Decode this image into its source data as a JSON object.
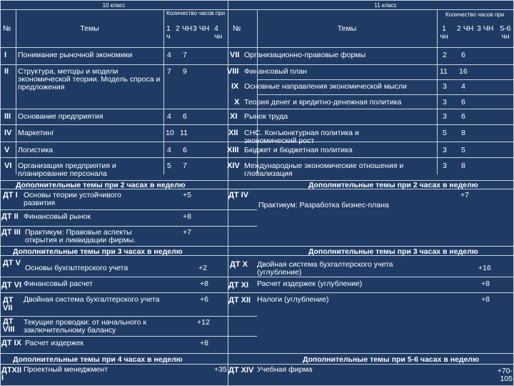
{
  "left_header": {
    "grade": "10 класс",
    "hours_title": "Количество часов при",
    "num": "№",
    "topics": "Темы",
    "col1": "1 ч",
    "col2": "2 ЧН",
    "col3": "3 ЧН",
    "col4": "4 чн"
  },
  "right_header": {
    "grade": "11 класс",
    "hours_title": "Количество часов при",
    "num": "№",
    "topics": "Темы",
    "col1": "1 чн",
    "col2": "2 ЧН",
    "col3": "3 ЧН",
    "col4": "5-6 чн"
  },
  "left_rows": [
    {
      "num": "I",
      "topic": "Понимание рыночной экономики",
      "h1": "4",
      "h2": "7"
    },
    {
      "num": "II",
      "topic": "Структура, методы и модели экономической теории. Модель спроса и предложения",
      "h1": "7",
      "h2": "9"
    },
    {
      "num": "III",
      "topic": "Основание предприятия",
      "h1": "4",
      "h2": "6"
    },
    {
      "num": "IV",
      "topic": "Маркетинг",
      "h1": "10",
      "h2": "11"
    },
    {
      "num": "V",
      "topic": "Логистика",
      "h1": "4",
      "h2": "6"
    },
    {
      "num": "VI",
      "topic": "Организация предприятия и планирование персонала",
      "h1": "5",
      "h2": "7"
    }
  ],
  "right_rows": [
    {
      "num": "VII",
      "topic": "Организационно-правовые формы",
      "h1": "2",
      "h2": "6"
    },
    {
      "num": "VIII",
      "topic": "Финансовый план",
      "h1": "11",
      "h2": "16"
    },
    {
      "num": "IX",
      "topic": "Основные направления экономической мысли",
      "h1": "3",
      "h2": "4"
    },
    {
      "num": "X",
      "topic": "Теория денег и кредитно-денежная политика",
      "h1": "3",
      "h2": "6"
    },
    {
      "num": "XI",
      "topic": "Рынок труда",
      "h1": "3",
      "h2": "6"
    },
    {
      "num": "XII",
      "topic": "СНС. Конъюнктурная политика и экономический рост",
      "h1": "5",
      "h2": "8"
    },
    {
      "num": "XIII",
      "topic": "Бюджет и бюджетная политика",
      "h1": "3",
      "h2": "5"
    },
    {
      "num": "XIV",
      "topic": "Международные экономические отношения и глобализация",
      "h1": "3",
      "h2": "8"
    }
  ],
  "left_add2": {
    "heading": "Дополнительные темы при 2 часах в неделю",
    "rows": [
      {
        "num": "ДТ I",
        "topic": "Основы теории устойчивого развития",
        "val": "+5"
      },
      {
        "num": "ДТ II",
        "topic": "Финансовый рынок",
        "val": "+8"
      },
      {
        "num": "ДТ III",
        "topic": "Практикум: Правовые аспекты открытия и ликвидации фирмы.",
        "val": "+7"
      }
    ]
  },
  "right_add2": {
    "heading": "Дополнительные темы при 2 часах в неделю",
    "rows": [
      {
        "num": "ДТ IV",
        "topic": "Практикум: Разработка бизнес-плана",
        "val": "+7"
      }
    ]
  },
  "left_add3": {
    "heading": "Дополнительные темы при 3 часах в неделю",
    "rows": [
      {
        "num": "ДТ V",
        "topic": "Основы бухгалтерского учета",
        "val": "+2"
      },
      {
        "num": "ДТ VI",
        "topic": "Финансовый расчет",
        "val": "+8"
      },
      {
        "num": "ДТ VII",
        "topic": "Двойная система бухгалтерского учета",
        "val": "+6"
      },
      {
        "num": "ДТ VIII",
        "topic": "Текущие проводки: от начального к заключительному балансу",
        "val": "+12"
      },
      {
        "num": "ДТ IX",
        "topic": "Расчет издержек",
        "val": "+8"
      }
    ]
  },
  "right_add3": {
    "heading": "Дополнительные темы при 3 часах в неделю",
    "rows": [
      {
        "num": "ДТ X",
        "topic": "Двойная система бухгалтерского учета (углубление)",
        "val": "+16"
      },
      {
        "num": "ДТ XI",
        "topic": "Расчет издержек (углубление)",
        "val": "+8"
      },
      {
        "num": "ДТ XII",
        "topic": "Налоги (углубление)",
        "val": "+8"
      }
    ]
  },
  "left_add4": {
    "heading": "Дополнительные темы при 4 часах в неделю",
    "rows": [
      {
        "num": "ДТXII I",
        "topic": "Проектный менеджмент",
        "val": "+35"
      }
    ]
  },
  "right_add56": {
    "heading": "Дополнительные темы при 5-6 часах в неделю",
    "rows": [
      {
        "num": "ДТ XIV",
        "topic": "Учебная фирма",
        "val": "+70-105"
      }
    ]
  }
}
